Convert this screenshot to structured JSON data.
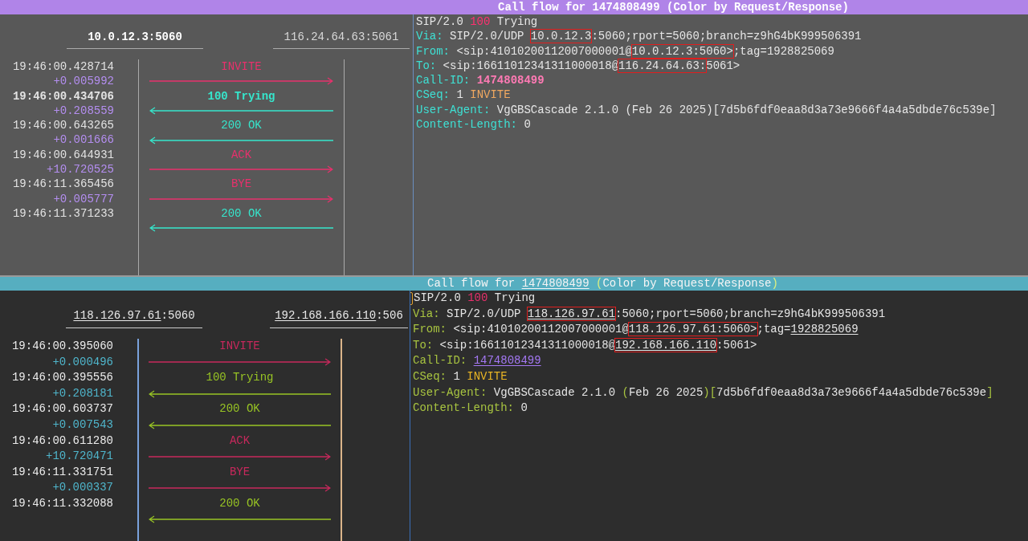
{
  "panels": [
    {
      "kind": "gray",
      "title": [
        {
          "text": "Call flow for 1474808499 (Color by Request/Response)",
          "kind": "plain"
        }
      ],
      "hosts": [
        {
          "bold": true,
          "parts": [
            {
              "text": "10.0.12.3:5060"
            }
          ]
        },
        {
          "bold": false,
          "parts": [
            {
              "text": "116.24.64.63:5061"
            }
          ]
        }
      ],
      "messages": [
        {
          "time": "19:46:00.428714",
          "delta": "+0.005992",
          "label": "INVITE",
          "kind": "request",
          "selected": false
        },
        {
          "time": "19:46:00.434706",
          "delta": "+0.208559",
          "label": "100 Trying",
          "kind": "response",
          "selected": true
        },
        {
          "time": "19:46:00.643265",
          "delta": "+0.001666",
          "label": "200 OK",
          "kind": "response",
          "selected": false
        },
        {
          "time": "19:46:00.644931",
          "delta": "+10.720525",
          "label": "ACK",
          "kind": "request",
          "selected": false
        },
        {
          "time": "19:46:11.365456",
          "delta": "+0.005777",
          "label": "BYE",
          "kind": "request",
          "selected": false
        },
        {
          "time": "19:46:11.371233",
          "label": "200 OK",
          "kind": "response",
          "selected": false
        }
      ],
      "detail": {
        "lines": [
          [
            {
              "text": "SIP/2.0 ",
              "kind": "plain"
            },
            {
              "text": "100",
              "kind": "code"
            },
            {
              "text": " Trying",
              "kind": "plain"
            }
          ],
          [
            {
              "text": "Via: ",
              "kind": "header"
            },
            {
              "text": "SIP/2.0/UDP ",
              "kind": "plain"
            },
            {
              "text": "10.0.12.3",
              "kind": "plain",
              "boxed": true
            },
            {
              "text": ":5060;rport=5060;branch=z9hG4bK999506391",
              "kind": "plain"
            }
          ],
          [
            {
              "text": "From: ",
              "kind": "header"
            },
            {
              "text": "<sip:41010200112007000001@",
              "kind": "plain"
            },
            {
              "text": "10.0.12.3:5060>",
              "kind": "plain",
              "boxed": true
            },
            {
              "text": ";tag=1928825069",
              "kind": "plain"
            }
          ],
          [
            {
              "text": "To: ",
              "kind": "header"
            },
            {
              "text": "<sip:16611012341311000018@",
              "kind": "plain"
            },
            {
              "text": "116.24.64.63:",
              "kind": "plain",
              "boxed": true
            },
            {
              "text": "5061>",
              "kind": "plain"
            }
          ],
          [
            {
              "text": "Call-ID: ",
              "kind": "header"
            },
            {
              "text": "1474808499",
              "kind": "callid"
            }
          ],
          [
            {
              "text": "CSeq: ",
              "kind": "header"
            },
            {
              "text": "1 ",
              "kind": "plain"
            },
            {
              "text": "INVITE",
              "kind": "method"
            }
          ],
          [
            {
              "text": "User-Agent: ",
              "kind": "header"
            },
            {
              "text": "VgGBSCascade 2.1.0 (Feb 26 2025)[7d5b6fdf0eaa8d3a73e9666f4a4a5dbde76c539e]",
              "kind": "plain"
            }
          ],
          [
            {
              "text": "Content-Length: ",
              "kind": "header"
            },
            {
              "text": "0",
              "kind": "plain"
            }
          ]
        ]
      }
    },
    {
      "kind": "dark",
      "title": [
        {
          "text": "Call flow for ",
          "kind": "plain"
        },
        {
          "text": "1474808499",
          "kind": "plain",
          "underline": true
        },
        {
          "text": " (",
          "kind": "punct"
        },
        {
          "text": "Color by Request/Response",
          "kind": "plain"
        },
        {
          "text": ")",
          "kind": "punct"
        }
      ],
      "hosts": [
        {
          "bold": false,
          "parts": [
            {
              "text": "118.126.97.61",
              "underline": true
            },
            {
              "text": ":5060"
            }
          ]
        },
        {
          "bold": false,
          "parts": [
            {
              "text": "192.168.166.110",
              "underline": true
            },
            {
              "text": ":506"
            }
          ]
        }
      ],
      "messages": [
        {
          "time": "19:46:00.395060",
          "delta": "+0.000496",
          "label": "INVITE",
          "kind": "request",
          "selected": false
        },
        {
          "time": "19:46:00.395556",
          "delta": "+0.208181",
          "label": "100 Trying",
          "kind": "response",
          "selected": false
        },
        {
          "time": "19:46:00.603737",
          "delta": "+0.007543",
          "label": "200 OK",
          "kind": "response",
          "selected": false
        },
        {
          "time": "19:46:00.611280",
          "delta": "+10.720471",
          "label": "ACK",
          "kind": "request",
          "selected": false
        },
        {
          "time": "19:46:11.331751",
          "delta": "+0.000337",
          "label": "BYE",
          "kind": "request",
          "selected": false
        },
        {
          "time": "19:46:11.332088",
          "label": "200 OK",
          "kind": "response",
          "selected": false
        }
      ],
      "detail": {
        "cursor": true,
        "lines": [
          [
            {
              "text": "SIP/2.0 ",
              "kind": "plain"
            },
            {
              "text": "100",
              "kind": "code"
            },
            {
              "text": " Trying",
              "kind": "plain"
            }
          ],
          [
            {
              "text": "Via: ",
              "kind": "header"
            },
            {
              "text": "SIP/2.0/UDP ",
              "kind": "plain"
            },
            {
              "text": "118.126.97.61",
              "kind": "plain",
              "boxed": true,
              "underline": true
            },
            {
              "text": ":5060;rport=5060;branch=z9hG4bK999506391",
              "kind": "plain"
            }
          ],
          [
            {
              "text": "From: ",
              "kind": "header"
            },
            {
              "text": "<sip:41010200112007000001@",
              "kind": "plain"
            },
            {
              "text": "118.126.97.61:5060>",
              "kind": "plain",
              "boxed": true
            },
            {
              "text": ";tag=",
              "kind": "plain"
            },
            {
              "text": "1928825069",
              "kind": "plain",
              "underline": true
            }
          ],
          [
            {
              "text": "To: ",
              "kind": "header"
            },
            {
              "text": "<sip:16611012341311000018@",
              "kind": "plain"
            },
            {
              "text": "192.168.166.110",
              "kind": "plain",
              "boxed": true,
              "underline": true
            },
            {
              "text": ":5061>",
              "kind": "plain"
            }
          ],
          [
            {
              "text": "Call-ID: ",
              "kind": "header"
            },
            {
              "text": "1474808499",
              "kind": "callid",
              "underline": true
            }
          ],
          [
            {
              "text": "CSeq: ",
              "kind": "header"
            },
            {
              "text": "1 ",
              "kind": "plain"
            },
            {
              "text": "INVITE",
              "kind": "method"
            }
          ],
          [
            {
              "text": "User-Agent: ",
              "kind": "header"
            },
            {
              "text": "VgGBSCascade 2.1.0 ",
              "kind": "plain"
            },
            {
              "text": "(",
              "kind": "punct"
            },
            {
              "text": "Feb 26 2025",
              "kind": "plain"
            },
            {
              "text": ")[",
              "kind": "punct"
            },
            {
              "text": "7d5b6fdf0eaa8d3a73e9666f4a4a5dbde76c539e",
              "kind": "plain"
            },
            {
              "text": "]",
              "kind": "punct"
            }
          ],
          [
            {
              "text": "Content-Length: ",
              "kind": "header"
            },
            {
              "text": "0",
              "kind": "plain"
            }
          ]
        ]
      }
    }
  ]
}
